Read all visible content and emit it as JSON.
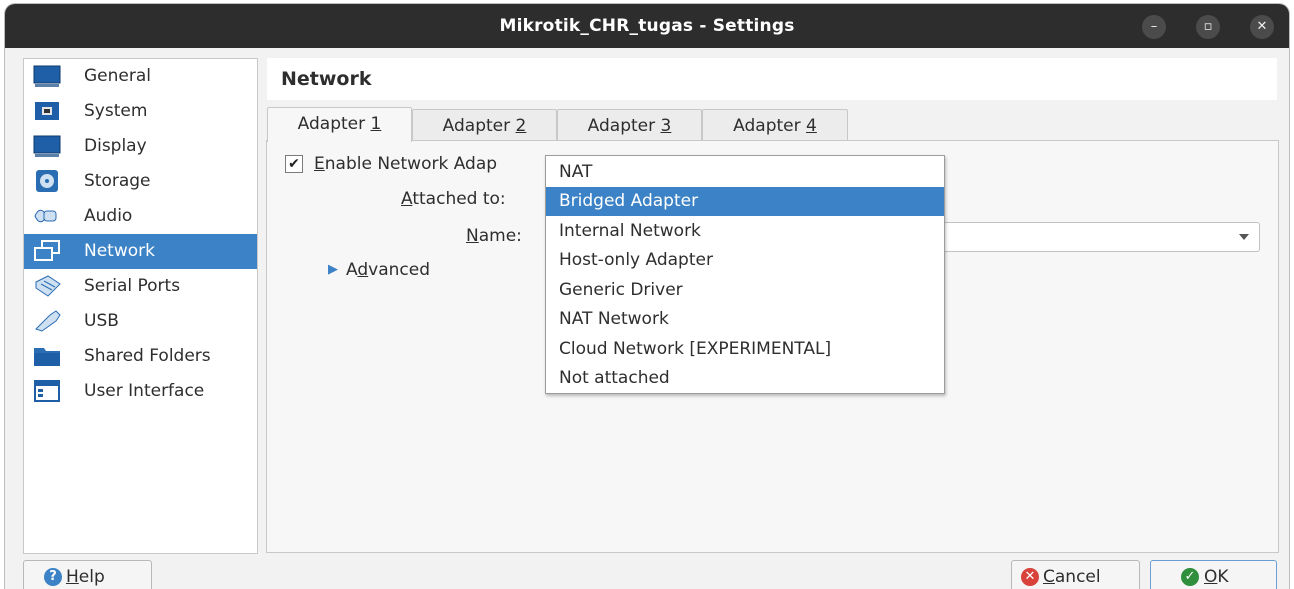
{
  "window": {
    "title": "Mikrotik_CHR_tugas - Settings",
    "minimize": "–",
    "maximize": "▫",
    "close": "✕"
  },
  "sidebar": {
    "items": [
      {
        "label": "General",
        "icon": "general-icon"
      },
      {
        "label": "System",
        "icon": "system-icon"
      },
      {
        "label": "Display",
        "icon": "display-icon"
      },
      {
        "label": "Storage",
        "icon": "storage-icon"
      },
      {
        "label": "Audio",
        "icon": "audio-icon"
      },
      {
        "label": "Network",
        "icon": "network-icon",
        "selected": true
      },
      {
        "label": "Serial Ports",
        "icon": "serial-ports-icon"
      },
      {
        "label": "USB",
        "icon": "usb-icon"
      },
      {
        "label": "Shared Folders",
        "icon": "shared-folders-icon"
      },
      {
        "label": "User Interface",
        "icon": "user-interface-icon"
      }
    ]
  },
  "panel": {
    "title": "Network"
  },
  "tabs": [
    {
      "label": "Adapter ",
      "key": "1"
    },
    {
      "label": "Adapter ",
      "key": "2"
    },
    {
      "label": "Adapter ",
      "key": "3"
    },
    {
      "label": "Adapter ",
      "key": "4"
    }
  ],
  "adapter": {
    "enable_prefix": "",
    "enable_key": "E",
    "enable_rest": "nable Network Adap",
    "enable_checked": true,
    "attached_key": "A",
    "attached_rest": "ttached to:",
    "name_key": "N",
    "name_rest": "ame:",
    "advanced_prefix": "A",
    "advanced_key": "d",
    "advanced_rest": "vanced"
  },
  "attached_dropdown": {
    "options": [
      "NAT",
      "Bridged Adapter",
      "Internal Network",
      "Host-only Adapter",
      "Generic Driver",
      "NAT Network",
      "Cloud Network [EXPERIMENTAL]",
      "Not attached"
    ],
    "selected": "Bridged Adapter"
  },
  "buttons": {
    "help_key": "H",
    "help_rest": "elp",
    "cancel_key": "C",
    "cancel_rest": "ancel",
    "ok_key": "O",
    "ok_rest": "K"
  },
  "colors": {
    "accent": "#3c82c6",
    "titlebar": "#2d2d2d",
    "cancel_icon": "#d9413b",
    "ok_icon": "#2f8f3c",
    "help_icon": "#3c82c6"
  }
}
